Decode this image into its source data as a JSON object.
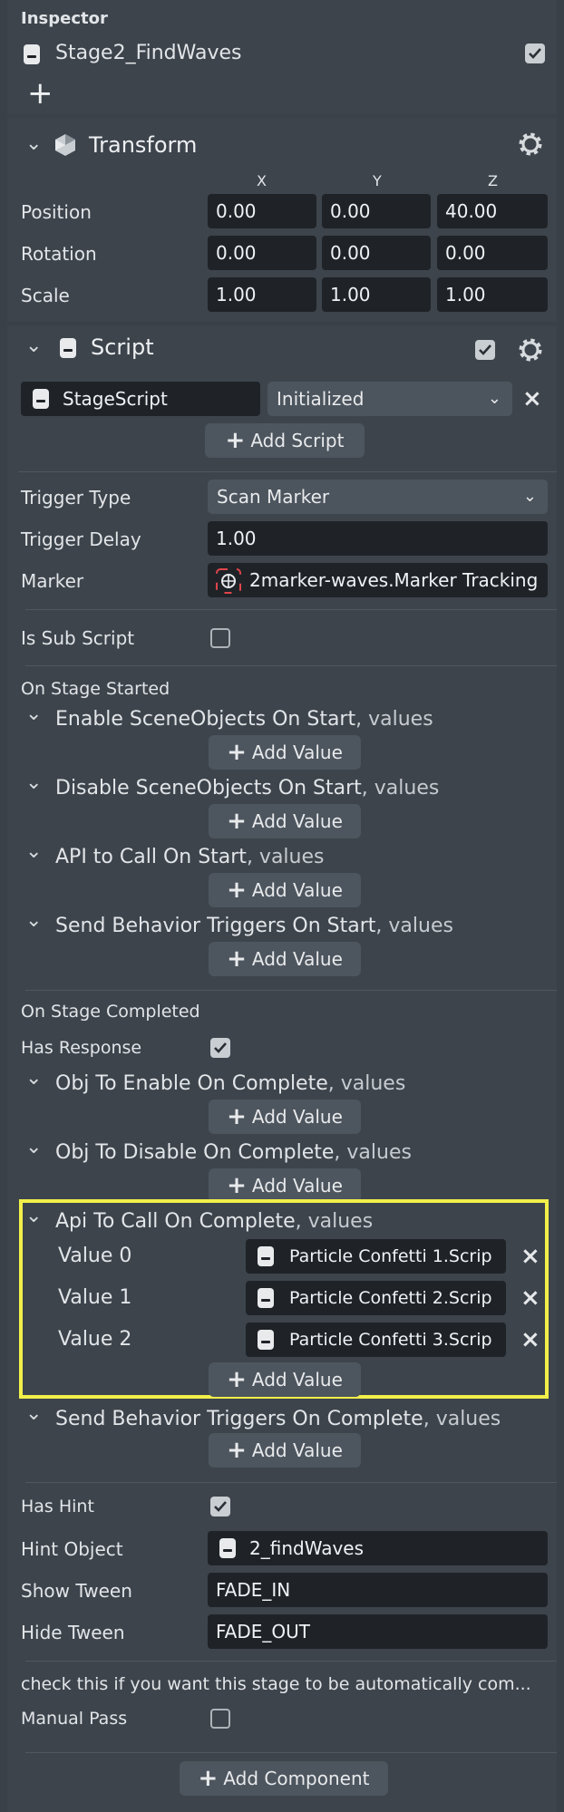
{
  "inspector": {
    "title": "Inspector",
    "object_name": "Stage2_FindWaves",
    "enabled": true,
    "add_label": "+"
  },
  "transform": {
    "title": "Transform",
    "axes": [
      "X",
      "Y",
      "Z"
    ],
    "rows": [
      {
        "label": "Position",
        "values": [
          "0.00",
          "0.00",
          "40.00"
        ]
      },
      {
        "label": "Rotation",
        "values": [
          "0.00",
          "0.00",
          "0.00"
        ]
      },
      {
        "label": "Scale",
        "values": [
          "1.00",
          "1.00",
          "1.00"
        ]
      }
    ]
  },
  "script": {
    "title": "Script",
    "enabled": true,
    "asset_name": "StageScript",
    "state": "Initialized",
    "add_script_label": "Add Script",
    "trigger_type_label": "Trigger Type",
    "trigger_type_value": "Scan Marker",
    "trigger_delay_label": "Trigger Delay",
    "trigger_delay_value": "1.00",
    "marker_label": "Marker",
    "marker_value": "2marker-waves.Marker Tracking",
    "is_sub_script_label": "Is Sub Script",
    "is_sub_script": false,
    "on_stage_started_label": "On Stage Started",
    "started_groups": [
      {
        "name": "Enable SceneObjects On Start",
        "suffix": ", values",
        "add": "Add Value"
      },
      {
        "name": "Disable SceneObjects On Start",
        "suffix": ", values",
        "add": "Add Value"
      },
      {
        "name": "API to Call On Start",
        "suffix": ", values",
        "add": "Add Value"
      },
      {
        "name": "Send Behavior Triggers On Start",
        "suffix": ", values",
        "add": "Add Value"
      }
    ],
    "on_stage_completed_label": "On Stage Completed",
    "has_response_label": "Has Response",
    "has_response": true,
    "completed_groups": [
      {
        "name": "Obj To Enable On Complete",
        "suffix": ", values",
        "add": "Add Value"
      },
      {
        "name": "Obj To Disable On Complete",
        "suffix": ", values",
        "add": "Add Value"
      }
    ],
    "api_group": {
      "name": "Api To Call On Complete",
      "suffix": ", values",
      "values": [
        {
          "label": "Value 0",
          "value": "Particle Confetti 1.Scrip"
        },
        {
          "label": "Value 1",
          "value": "Particle Confetti 2.Scrip"
        },
        {
          "label": "Value 2",
          "value": "Particle Confetti 3.Scrip"
        }
      ],
      "add": "Add Value"
    },
    "send_group": {
      "name": "Send Behavior Triggers On Complete",
      "suffix": ", values",
      "add": "Add Value"
    },
    "has_hint_label": "Has Hint",
    "has_hint": true,
    "hint_object_label": "Hint Object",
    "hint_object_value": "2_findWaves",
    "show_tween_label": "Show Tween",
    "show_tween_value": "FADE_IN",
    "hide_tween_label": "Hide Tween",
    "hide_tween_value": "FADE_OUT",
    "manual_pass_note": "check this if you want this stage to be automatically com...",
    "manual_pass_label": "Manual Pass",
    "manual_pass": false
  },
  "footer": {
    "add_component_label": "Add Component"
  },
  "colors": {
    "highlight": "#f2ef4a",
    "background": "#3a4047",
    "field": "#1f2328"
  }
}
